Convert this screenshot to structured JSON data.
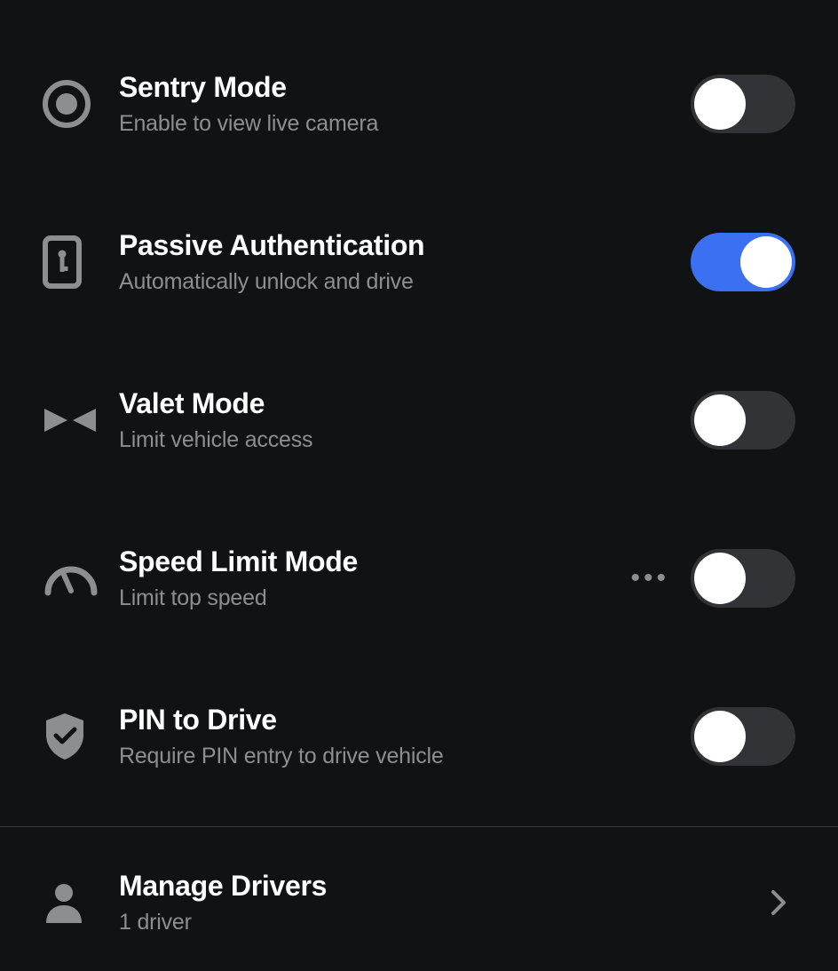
{
  "settings": [
    {
      "id": "sentry",
      "title": "Sentry Mode",
      "subtitle": "Enable to view live camera",
      "on": false,
      "more": false
    },
    {
      "id": "passive_auth",
      "title": "Passive Authentication",
      "subtitle": "Automatically unlock and drive",
      "on": true,
      "more": false
    },
    {
      "id": "valet",
      "title": "Valet Mode",
      "subtitle": "Limit vehicle access",
      "on": false,
      "more": false
    },
    {
      "id": "speed_limit",
      "title": "Speed Limit Mode",
      "subtitle": "Limit top speed",
      "on": false,
      "more": true
    },
    {
      "id": "pin_drive",
      "title": "PIN to Drive",
      "subtitle": "Require PIN entry to drive vehicle",
      "on": false,
      "more": false
    }
  ],
  "manage_drivers": {
    "title": "Manage Drivers",
    "subtitle": "1 driver"
  }
}
